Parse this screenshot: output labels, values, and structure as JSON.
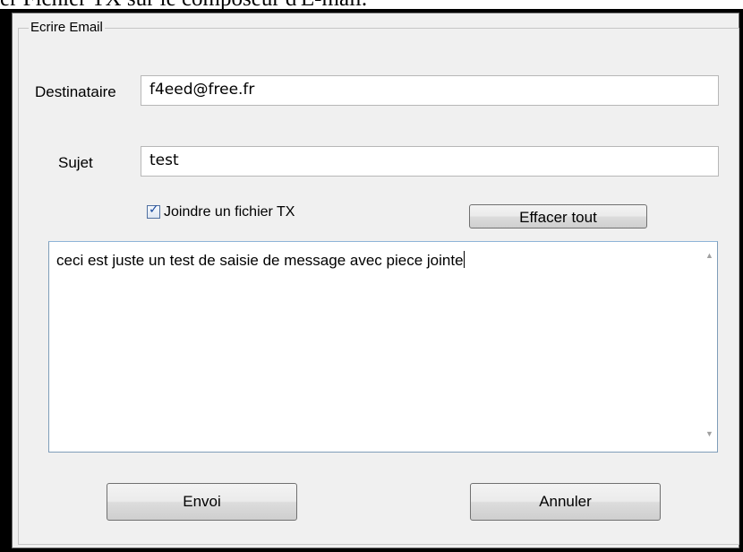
{
  "caption": "er Fichier TX sur le composeur d'E-mail.",
  "dialog": {
    "group_title": "Ecrire Email",
    "recipient": {
      "label": "Destinataire",
      "value": "f4eed@free.fr"
    },
    "subject": {
      "label": "Sujet",
      "value": "test"
    },
    "attach": {
      "label": "Joindre un fichier TX",
      "checked": true
    },
    "clear_button": "Effacer tout",
    "message": "ceci est juste un test de saisie de message avec piece jointe",
    "send_button": "Envoi",
    "cancel_button": "Annuler"
  }
}
